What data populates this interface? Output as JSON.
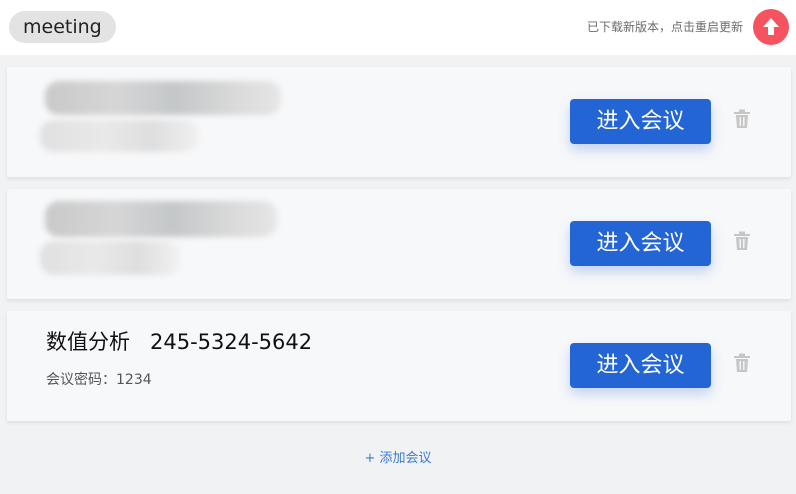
{
  "header": {
    "app_name": "meeting",
    "update_notice": "已下载新版本，点击重启更新",
    "update_icon": "arrow-up-icon",
    "accent_color": "#f5535f"
  },
  "meetings": [
    {
      "title": "",
      "number": "",
      "password_label": "",
      "password": "",
      "blurred": true,
      "enter_label": "进入会议",
      "delete_icon": "trash-icon"
    },
    {
      "title": "",
      "number": "",
      "password_label": "",
      "password": "",
      "blurred": true,
      "enter_label": "进入会议",
      "delete_icon": "trash-icon"
    },
    {
      "title": "数值分析",
      "number": "245-5324-5642",
      "password_label": "会议密码：",
      "password": "1234",
      "blurred": false,
      "enter_label": "进入会议",
      "delete_icon": "trash-icon"
    }
  ],
  "footer": {
    "add_label": "+ 添加会议"
  },
  "colors": {
    "primary_button": "#2365d5",
    "link": "#3a7bd5"
  }
}
